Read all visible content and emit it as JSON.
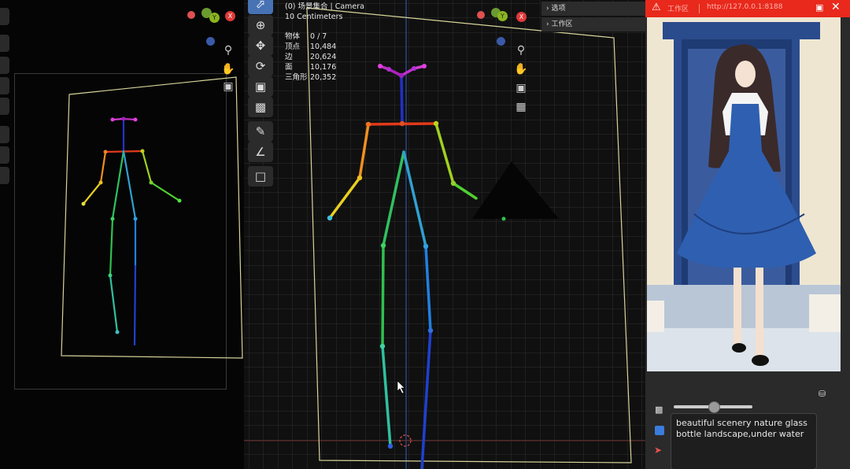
{
  "left_viewport": {
    "toolbar_icons": [
      "cursor-icon",
      "move-icon",
      "rotate-icon",
      "scale-icon",
      "transform-icon",
      "annotate-icon",
      "measure-icon"
    ],
    "gizmo_labels": {
      "y": "Y",
      "x": "X"
    },
    "nav_icons": [
      "zoom-icon",
      "hand-icon",
      "camera-icon"
    ]
  },
  "mid_viewport": {
    "toolbar_icons": [
      "select-box-icon",
      "cursor-icon",
      "move-icon",
      "rotate-icon",
      "scale-icon",
      "transform-icon",
      "annotate-icon",
      "measure-icon",
      "add-cube-icon"
    ],
    "header": "(0) 场景集合 | Camera",
    "grid_scale": "10 Centimeters",
    "stats": [
      {
        "label": "物体",
        "value": "0 / 7"
      },
      {
        "label": "顶点",
        "value": "10,484"
      },
      {
        "label": "边",
        "value": "20,624"
      },
      {
        "label": "面",
        "value": "10,176"
      },
      {
        "label": "三角形",
        "value": "20,352"
      }
    ],
    "gizmo_labels": {
      "y": "Y",
      "x": "X"
    },
    "nav_icons": [
      "zoom-icon",
      "hand-icon",
      "camera-icon",
      "grid-icon"
    ],
    "collapse_panel": [
      {
        "label": "选项"
      },
      {
        "label": "工作区"
      }
    ]
  },
  "right_panel": {
    "title": "工作区",
    "url": "http://127.0.0.1:8188",
    "prompt": "beautiful scenery nature glass bottle landscape,under water",
    "slider_value": 0.5,
    "colors": {
      "titlebar": "#e8291c",
      "dress": "#2f5fb0"
    }
  }
}
